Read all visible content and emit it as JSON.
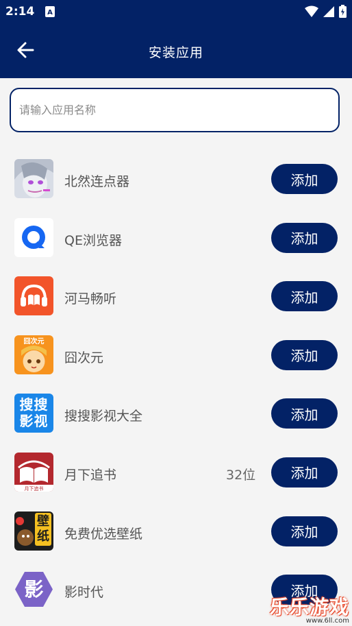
{
  "status_bar": {
    "time": "2:14"
  },
  "app_bar": {
    "title": "安装应用"
  },
  "search": {
    "placeholder": "请输入应用名称",
    "value": ""
  },
  "apps": [
    {
      "name": "北然连点器",
      "extra": "",
      "button": "添加",
      "icon": "anime-avatar-icon"
    },
    {
      "name": "QE浏览器",
      "extra": "",
      "button": "添加",
      "icon": "qe-browser-icon"
    },
    {
      "name": "河马畅听",
      "extra": "",
      "button": "添加",
      "icon": "headphones-book-icon"
    },
    {
      "name": "囧次元",
      "extra": "",
      "button": "添加",
      "icon": "jiongciyuan-icon",
      "icon_text": "囧次元"
    },
    {
      "name": "搜搜影视大全",
      "extra": "",
      "button": "添加",
      "icon": "sousou-icon",
      "icon_text": "搜搜影视"
    },
    {
      "name": "月下追书",
      "extra": "32位",
      "button": "添加",
      "icon": "open-book-icon",
      "icon_text": "月下追书"
    },
    {
      "name": "免费优选壁纸",
      "extra": "",
      "button": "添加",
      "icon": "wallpaper-icon",
      "icon_text": "壁纸"
    },
    {
      "name": "影时代",
      "extra": "",
      "button": "添加",
      "icon": "hexagon-ying-icon",
      "icon_text": "影"
    }
  ],
  "watermark": {
    "title": "乐乐游戏",
    "url": "www.6ll.com"
  },
  "colors": {
    "primary": "#032266",
    "background": "#f4f4f4"
  }
}
